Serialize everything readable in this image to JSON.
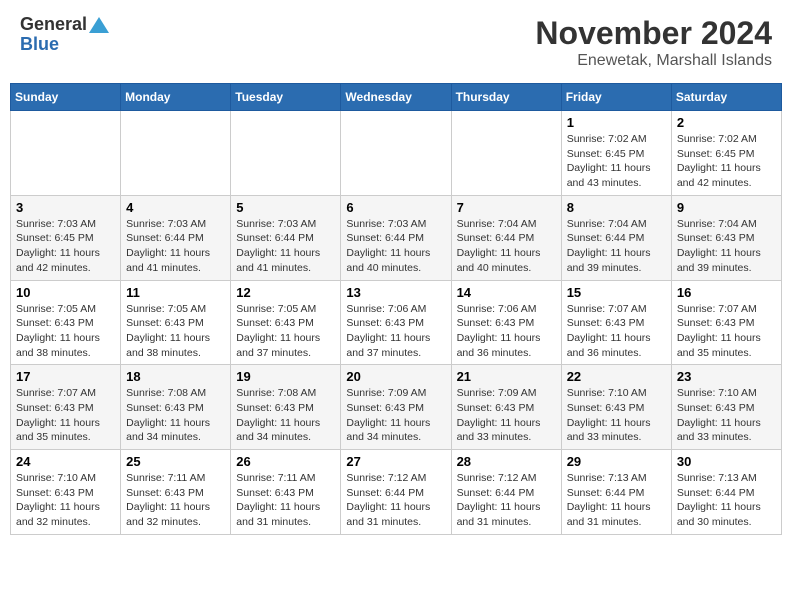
{
  "header": {
    "logo_line1": "General",
    "logo_line2": "Blue",
    "title": "November 2024",
    "subtitle": "Enewetak, Marshall Islands"
  },
  "calendar": {
    "days_of_week": [
      "Sunday",
      "Monday",
      "Tuesday",
      "Wednesday",
      "Thursday",
      "Friday",
      "Saturday"
    ],
    "weeks": [
      [
        {
          "day": "",
          "info": ""
        },
        {
          "day": "",
          "info": ""
        },
        {
          "day": "",
          "info": ""
        },
        {
          "day": "",
          "info": ""
        },
        {
          "day": "",
          "info": ""
        },
        {
          "day": "1",
          "info": "Sunrise: 7:02 AM\nSunset: 6:45 PM\nDaylight: 11 hours and 43 minutes."
        },
        {
          "day": "2",
          "info": "Sunrise: 7:02 AM\nSunset: 6:45 PM\nDaylight: 11 hours and 42 minutes."
        }
      ],
      [
        {
          "day": "3",
          "info": "Sunrise: 7:03 AM\nSunset: 6:45 PM\nDaylight: 11 hours and 42 minutes."
        },
        {
          "day": "4",
          "info": "Sunrise: 7:03 AM\nSunset: 6:44 PM\nDaylight: 11 hours and 41 minutes."
        },
        {
          "day": "5",
          "info": "Sunrise: 7:03 AM\nSunset: 6:44 PM\nDaylight: 11 hours and 41 minutes."
        },
        {
          "day": "6",
          "info": "Sunrise: 7:03 AM\nSunset: 6:44 PM\nDaylight: 11 hours and 40 minutes."
        },
        {
          "day": "7",
          "info": "Sunrise: 7:04 AM\nSunset: 6:44 PM\nDaylight: 11 hours and 40 minutes."
        },
        {
          "day": "8",
          "info": "Sunrise: 7:04 AM\nSunset: 6:44 PM\nDaylight: 11 hours and 39 minutes."
        },
        {
          "day": "9",
          "info": "Sunrise: 7:04 AM\nSunset: 6:43 PM\nDaylight: 11 hours and 39 minutes."
        }
      ],
      [
        {
          "day": "10",
          "info": "Sunrise: 7:05 AM\nSunset: 6:43 PM\nDaylight: 11 hours and 38 minutes."
        },
        {
          "day": "11",
          "info": "Sunrise: 7:05 AM\nSunset: 6:43 PM\nDaylight: 11 hours and 38 minutes."
        },
        {
          "day": "12",
          "info": "Sunrise: 7:05 AM\nSunset: 6:43 PM\nDaylight: 11 hours and 37 minutes."
        },
        {
          "day": "13",
          "info": "Sunrise: 7:06 AM\nSunset: 6:43 PM\nDaylight: 11 hours and 37 minutes."
        },
        {
          "day": "14",
          "info": "Sunrise: 7:06 AM\nSunset: 6:43 PM\nDaylight: 11 hours and 36 minutes."
        },
        {
          "day": "15",
          "info": "Sunrise: 7:07 AM\nSunset: 6:43 PM\nDaylight: 11 hours and 36 minutes."
        },
        {
          "day": "16",
          "info": "Sunrise: 7:07 AM\nSunset: 6:43 PM\nDaylight: 11 hours and 35 minutes."
        }
      ],
      [
        {
          "day": "17",
          "info": "Sunrise: 7:07 AM\nSunset: 6:43 PM\nDaylight: 11 hours and 35 minutes."
        },
        {
          "day": "18",
          "info": "Sunrise: 7:08 AM\nSunset: 6:43 PM\nDaylight: 11 hours and 34 minutes."
        },
        {
          "day": "19",
          "info": "Sunrise: 7:08 AM\nSunset: 6:43 PM\nDaylight: 11 hours and 34 minutes."
        },
        {
          "day": "20",
          "info": "Sunrise: 7:09 AM\nSunset: 6:43 PM\nDaylight: 11 hours and 34 minutes."
        },
        {
          "day": "21",
          "info": "Sunrise: 7:09 AM\nSunset: 6:43 PM\nDaylight: 11 hours and 33 minutes."
        },
        {
          "day": "22",
          "info": "Sunrise: 7:10 AM\nSunset: 6:43 PM\nDaylight: 11 hours and 33 minutes."
        },
        {
          "day": "23",
          "info": "Sunrise: 7:10 AM\nSunset: 6:43 PM\nDaylight: 11 hours and 33 minutes."
        }
      ],
      [
        {
          "day": "24",
          "info": "Sunrise: 7:10 AM\nSunset: 6:43 PM\nDaylight: 11 hours and 32 minutes."
        },
        {
          "day": "25",
          "info": "Sunrise: 7:11 AM\nSunset: 6:43 PM\nDaylight: 11 hours and 32 minutes."
        },
        {
          "day": "26",
          "info": "Sunrise: 7:11 AM\nSunset: 6:43 PM\nDaylight: 11 hours and 31 minutes."
        },
        {
          "day": "27",
          "info": "Sunrise: 7:12 AM\nSunset: 6:44 PM\nDaylight: 11 hours and 31 minutes."
        },
        {
          "day": "28",
          "info": "Sunrise: 7:12 AM\nSunset: 6:44 PM\nDaylight: 11 hours and 31 minutes."
        },
        {
          "day": "29",
          "info": "Sunrise: 7:13 AM\nSunset: 6:44 PM\nDaylight: 11 hours and 31 minutes."
        },
        {
          "day": "30",
          "info": "Sunrise: 7:13 AM\nSunset: 6:44 PM\nDaylight: 11 hours and 30 minutes."
        }
      ]
    ]
  }
}
